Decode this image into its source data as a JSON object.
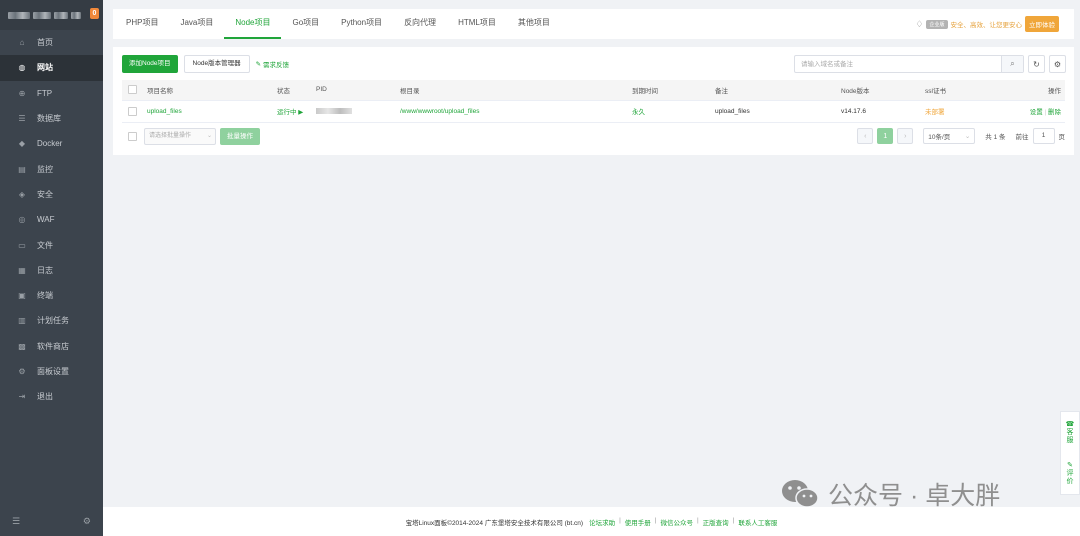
{
  "sidebar": {
    "badge": "0",
    "items": [
      {
        "icon": "home-icon",
        "glyph": "⌂",
        "label": "首页"
      },
      {
        "icon": "globe-icon",
        "glyph": "◍",
        "label": "网站",
        "active": true
      },
      {
        "icon": "ftp-icon",
        "glyph": "⊕",
        "label": "FTP"
      },
      {
        "icon": "database-icon",
        "glyph": "☰",
        "label": "数据库"
      },
      {
        "icon": "docker-icon",
        "glyph": "◆",
        "label": "Docker"
      },
      {
        "icon": "monitor-icon",
        "glyph": "▤",
        "label": "监控"
      },
      {
        "icon": "shield-icon",
        "glyph": "◈",
        "label": "安全"
      },
      {
        "icon": "waf-icon",
        "glyph": "◎",
        "label": "WAF"
      },
      {
        "icon": "folder-icon",
        "glyph": "▭",
        "label": "文件"
      },
      {
        "icon": "log-icon",
        "glyph": "▦",
        "label": "日志"
      },
      {
        "icon": "terminal-icon",
        "glyph": "▣",
        "label": "终端"
      },
      {
        "icon": "cron-icon",
        "glyph": "▥",
        "label": "计划任务"
      },
      {
        "icon": "store-icon",
        "glyph": "▩",
        "label": "软件商店"
      },
      {
        "icon": "settings-icon",
        "glyph": "⚙",
        "label": "面板设置"
      },
      {
        "icon": "logout-icon",
        "glyph": "⇥",
        "label": "退出"
      }
    ]
  },
  "tabs": [
    "PHP项目",
    "Java项目",
    "Node项目",
    "Go项目",
    "Python项目",
    "反向代理",
    "HTML项目",
    "其他项目"
  ],
  "active_tab": "Node项目",
  "promo": {
    "tag": "企业版",
    "text": "安全、高效、让您更安心",
    "button": "立即体验"
  },
  "toolbar": {
    "add_label": "添加Node项目",
    "version_label": "Node版本管理器",
    "feedback_label": "需求反馈"
  },
  "search": {
    "placeholder": "请输入域名或备注"
  },
  "table": {
    "headers": [
      "项目名称",
      "状态",
      "PID",
      "根目录",
      "到期时间",
      "备注",
      "Node版本",
      "ssl证书",
      "操作"
    ],
    "rows": [
      {
        "name": "upload_files",
        "status": "运行中 ▶",
        "root": "/www/wwwroot/upload_files",
        "expire": "永久",
        "remark": "upload_files",
        "node_version": "v14.17.6",
        "ssl": "未部署",
        "action_settings": "设置",
        "action_delete": "删除"
      }
    ]
  },
  "batch": {
    "select_placeholder": "请选择批量操作",
    "button": "批量操作"
  },
  "pager": {
    "current": "1",
    "page_size": "10条/页",
    "total": "共 1 条",
    "goto_label": "前往",
    "goto_value": "1",
    "page_unit": "页"
  },
  "float": {
    "service": "客服",
    "review": "评价"
  },
  "watermark": "公众号 · 卓大胖",
  "footer": {
    "copyright": "宝塔Linux面板©2014-2024 广东堡塔安全技术有限公司 (bt.cn)",
    "links": [
      "论坛求助",
      "使用手册",
      "微信公众号",
      "正版查询",
      "联系人工客服"
    ]
  }
}
